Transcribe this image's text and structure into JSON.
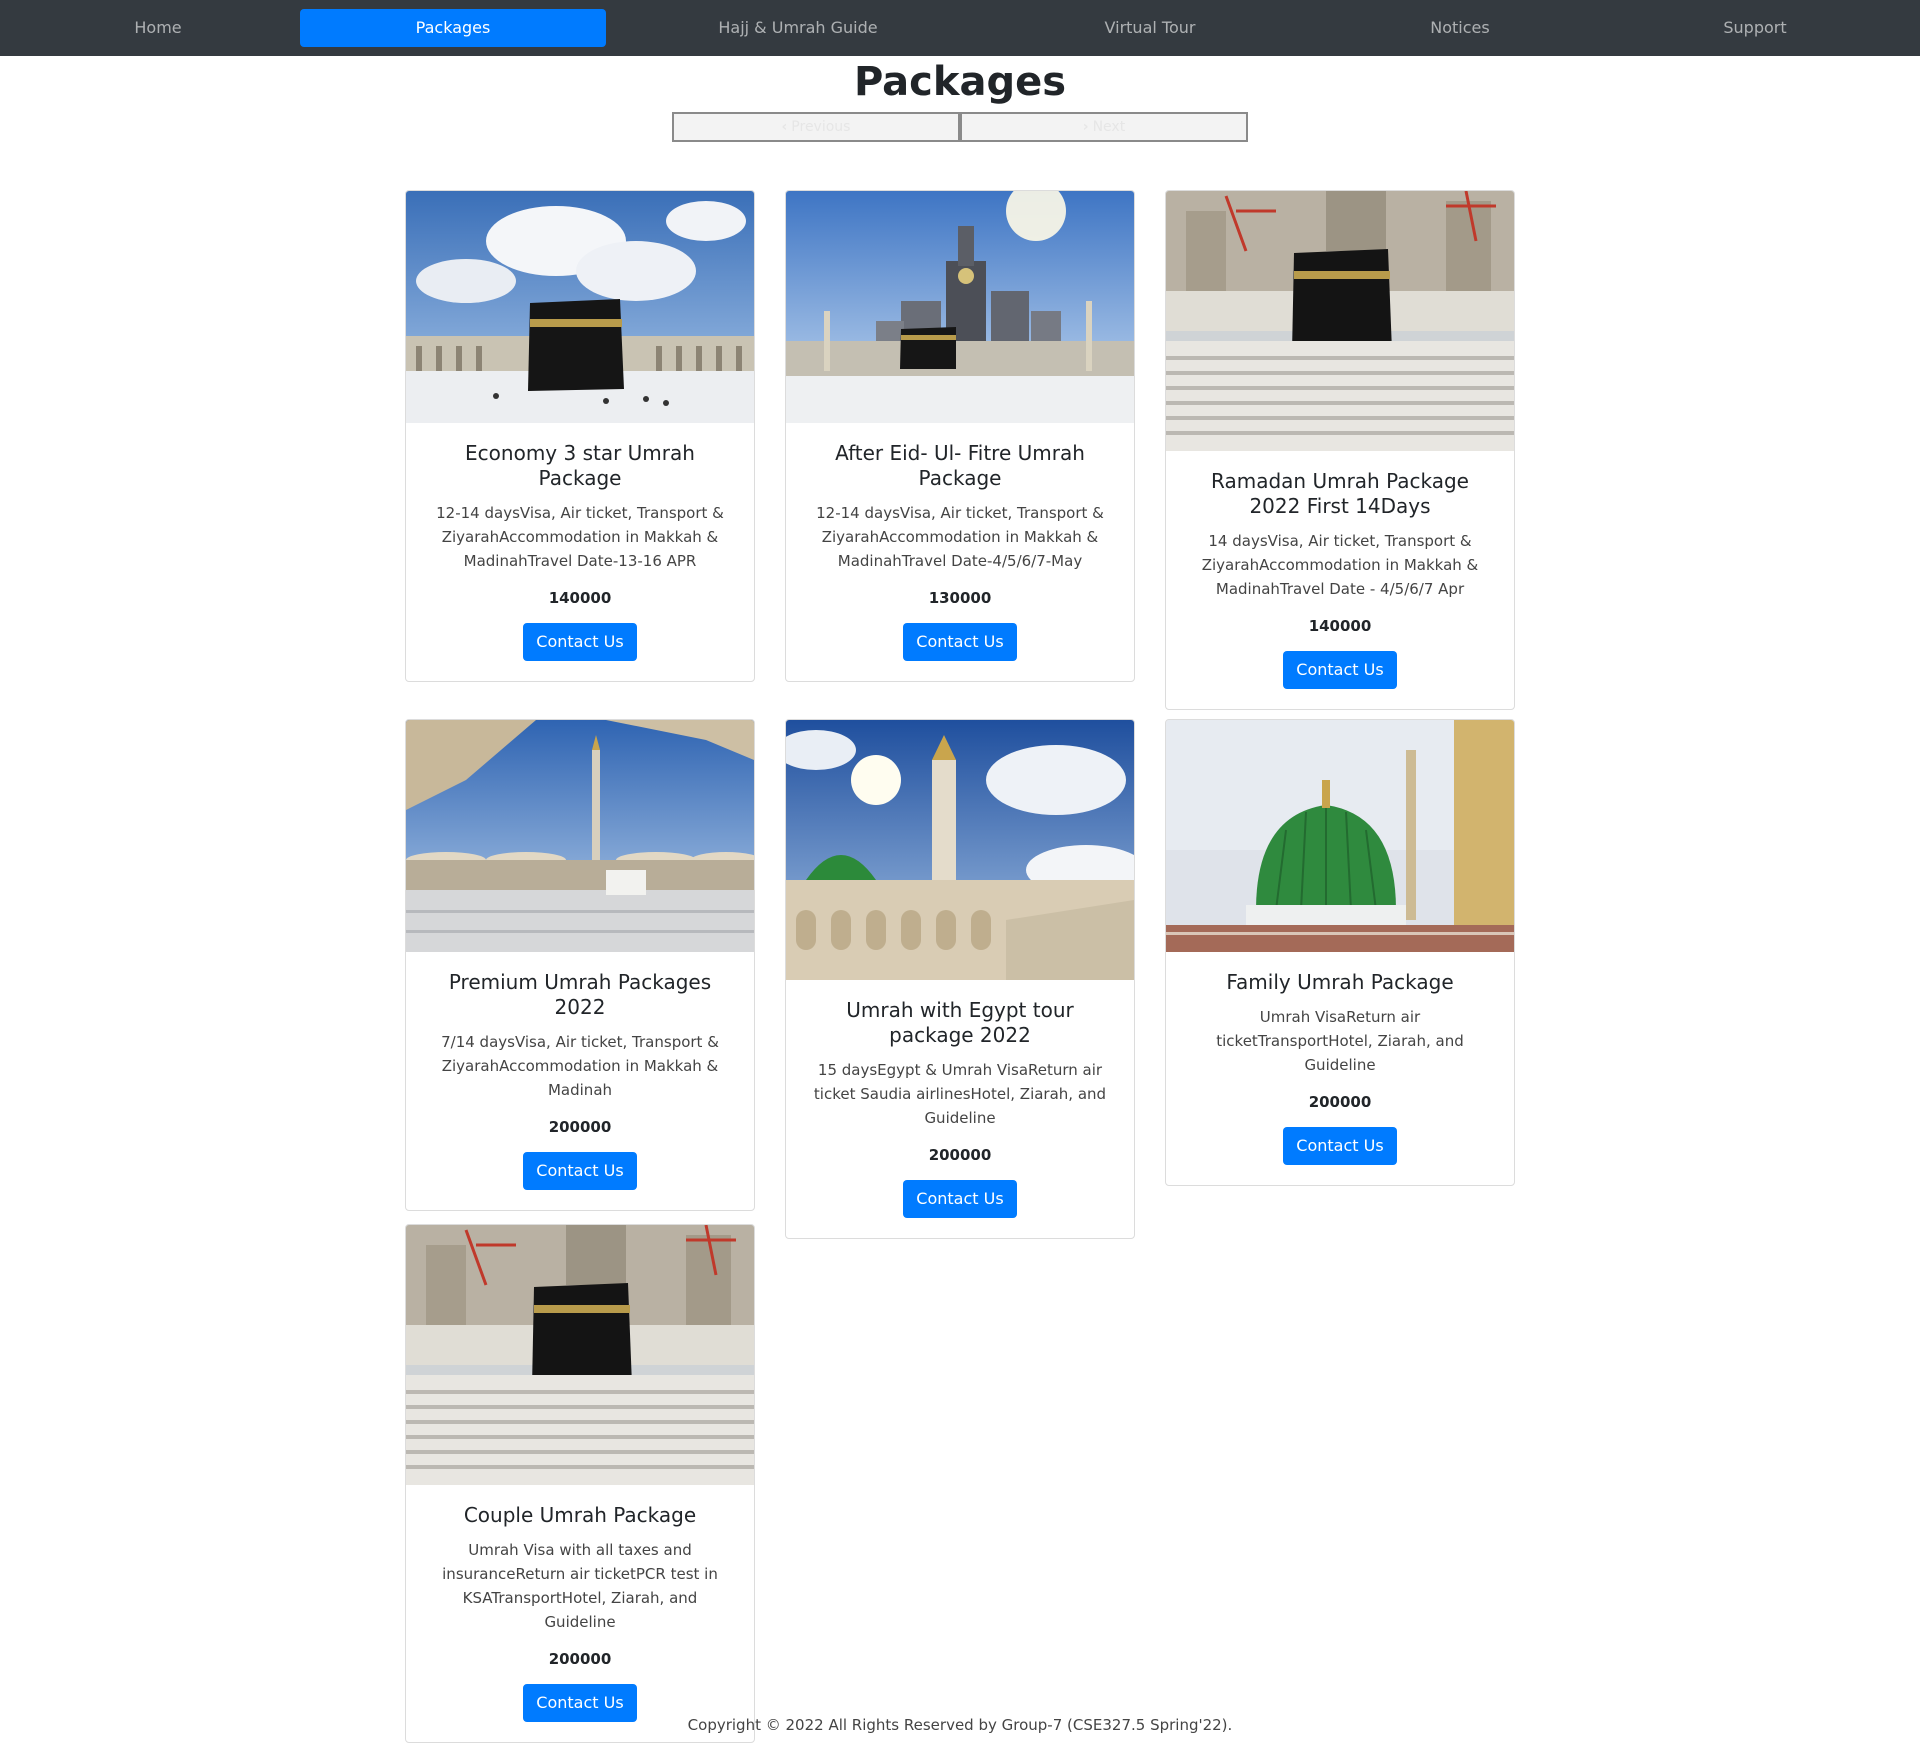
{
  "nav": {
    "items": [
      "Home",
      "Packages",
      "Hajj & Umrah Guide",
      "Virtual Tour",
      "Notices",
      "Support"
    ],
    "active_index": 1
  },
  "page": {
    "title": "Packages",
    "prev_label": "Previous",
    "next_label": "Next"
  },
  "packages": [
    {
      "title": "Economy 3 star Umrah Package",
      "description": "12-14 daysVisa, Air ticket, Transport & ZiyarahAccommodation in Makkah & MadinahTravel Date-13-16 APR",
      "price": "140000",
      "button": "Contact Us"
    },
    {
      "title": "After Eid- Ul- Fitre Umrah Package",
      "description": "12-14 daysVisa, Air ticket, Transport & ZiyarahAccommodation in Makkah & MadinahTravel Date-4/5/6/7-May",
      "price": "130000",
      "button": "Contact Us"
    },
    {
      "title": "Ramadan Umrah Package 2022 First 14Days",
      "description": "14 daysVisa, Air ticket, Transport & ZiyarahAccommodation in Makkah & MadinahTravel Date - 4/5/6/7 Apr",
      "price": "140000",
      "button": "Contact Us"
    },
    {
      "title": "Premium Umrah Packages 2022",
      "description": "7/14 daysVisa, Air ticket, Transport & ZiyarahAccommodation in Makkah & Madinah",
      "price": "200000",
      "button": "Contact Us"
    },
    {
      "title": "Umrah with Egypt tour package 2022",
      "description": "15 daysEgypt & Umrah VisaReturn air ticket Saudia airlinesHotel, Ziarah, and Guideline",
      "price": "200000",
      "button": "Contact Us"
    },
    {
      "title": "Family Umrah Package",
      "description": "Umrah VisaReturn air ticketTransportHotel, Ziarah, and Guideline",
      "price": "200000",
      "button": "Contact Us"
    },
    {
      "title": "Couple Umrah Package",
      "description": "Umrah Visa with all taxes and insuranceReturn air ticketPCR test in KSATransportHotel, Ziarah, and Guideline",
      "price": "200000",
      "button": "Contact Us"
    }
  ],
  "footer": {
    "text": "Copyright © 2022 All Rights Reserved by Group-7 (CSE327.5 Spring'22)."
  }
}
